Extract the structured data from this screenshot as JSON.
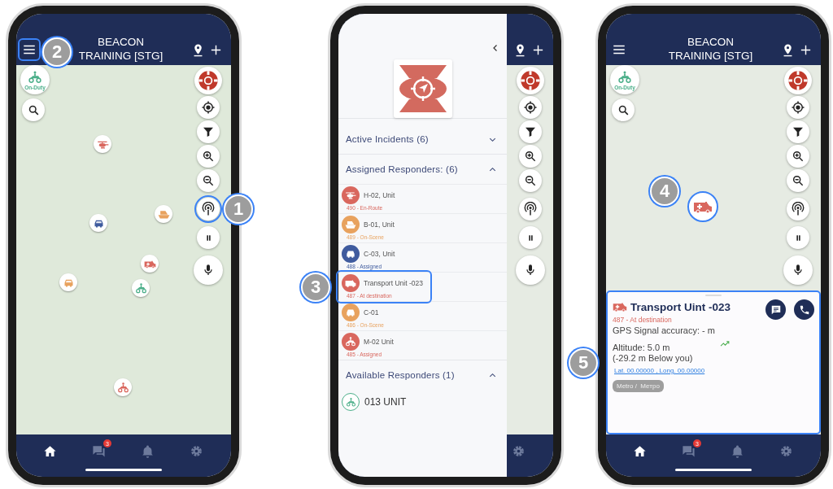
{
  "phones": [
    {
      "kind": "map",
      "header": {
        "menu": true,
        "menu_callout": "2",
        "title": [
          "BEACON",
          "TRAINING [STG]"
        ]
      },
      "on_duty": "On-Duty",
      "broadcast_callout": "1",
      "markers": true,
      "nav": [
        {
          "kind": "home",
          "selected": true
        },
        {
          "kind": "chat",
          "selected": false,
          "badge": "3"
        },
        {
          "kind": "bell",
          "selected": false
        },
        {
          "kind": "gear",
          "selected": false
        }
      ]
    },
    {
      "kind": "drawer",
      "nav": [
        {
          "kind": "gear",
          "selected": false
        }
      ],
      "drawer": {
        "sections": [
          {
            "title": "Active Incidents (6)",
            "expanded": false
          },
          {
            "title": "Assigned Responders: (6)",
            "expanded": true,
            "items": [
              {
                "name": "H-02, Unit",
                "status": "490 - En-Route",
                "kind": "helicopter",
                "color": "#d9675e"
              },
              {
                "name": "B-01, Unit",
                "status": "489 - On-Scene",
                "kind": "boat",
                "color": "#e8a25e"
              },
              {
                "name": "C-03, Unit",
                "status": "488 - Assigned",
                "kind": "car",
                "color": "#3f5b9e"
              },
              {
                "name": "Transport Unit -023",
                "status": "487 - At destination",
                "kind": "ambulance",
                "color": "#d9675e",
                "callout": "3"
              },
              {
                "name": "C-01",
                "status": "486 - On-Scene",
                "kind": "car",
                "color": "#e8a25e"
              },
              {
                "name": "M-02 Unit",
                "status": "485 - Assigned",
                "kind": "atv",
                "color": "#d9675e"
              }
            ]
          },
          {
            "title": "Available Responders (1)",
            "expanded": true,
            "items": [
              {
                "name": "013 UNIT",
                "kind": "atv",
                "color": "#4caf8a"
              }
            ]
          }
        ]
      }
    },
    {
      "kind": "map",
      "header": {
        "menu": true,
        "title": [
          "BEACON",
          "TRAINING [STG]"
        ]
      },
      "on_duty": "On-Duty",
      "marker": {
        "kind": "ambulance",
        "callout": "4"
      },
      "panel": {
        "kind": "ambulance",
        "title": "Transport Uint -023",
        "status": "487 - At destination",
        "accuracy": "GPS Signal accuracy: - m",
        "altitude": "Altitude: 5.0 m",
        "relative": "(-29.2 m Below you)",
        "coords": "Lat. 00.00000 , Long. 00.00000",
        "tag": "Metro /  Метро",
        "callout": "5"
      },
      "nav": [
        {
          "kind": "home",
          "selected": true
        },
        {
          "kind": "chat",
          "selected": false,
          "badge": "3"
        },
        {
          "kind": "bell",
          "selected": false
        },
        {
          "kind": "gear",
          "selected": false
        }
      ]
    }
  ]
}
